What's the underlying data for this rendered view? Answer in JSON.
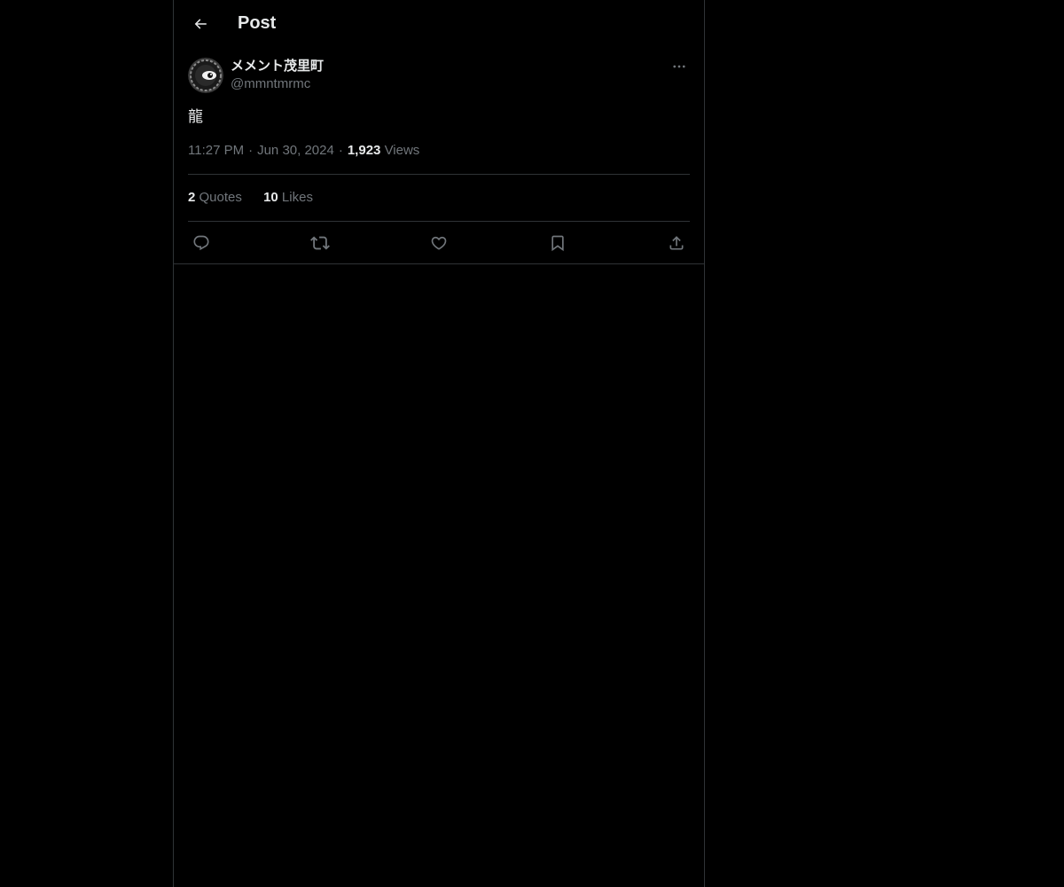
{
  "colors": {
    "background": "#000000",
    "border": "#2f3336",
    "primary_text": "#e7e9ea",
    "secondary_text": "#71767b"
  },
  "header": {
    "title": "Post",
    "back_icon": "arrow-left-icon"
  },
  "post": {
    "author": {
      "display_name": "メメント茂里町",
      "handle": "@mmntmrmc",
      "avatar_icon": "eye-avatar"
    },
    "more_icon": "more-horizontal-icon",
    "text": "龍",
    "time": "11:27 PM",
    "date": "Jun 30, 2024",
    "separator": "·",
    "views_count": "1,923",
    "views_label": "Views",
    "stats": {
      "quotes_count": "2",
      "quotes_label": "Quotes",
      "likes_count": "10",
      "likes_label": "Likes"
    },
    "actions": [
      {
        "icon": "reply-icon"
      },
      {
        "icon": "repost-icon"
      },
      {
        "icon": "like-icon"
      },
      {
        "icon": "bookmark-icon"
      },
      {
        "icon": "share-icon"
      }
    ]
  }
}
